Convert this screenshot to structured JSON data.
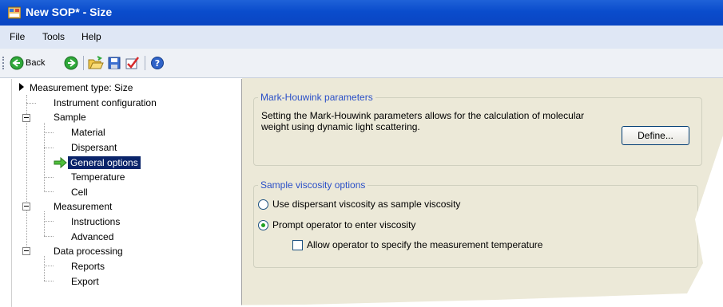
{
  "window": {
    "title": "New SOP* - Size"
  },
  "menu": {
    "items": [
      "File",
      "Tools",
      "Help"
    ]
  },
  "toolbar": {
    "back_label": "Back"
  },
  "tree": {
    "root": "Measurement type: Size",
    "items": [
      {
        "label": "Instrument configuration",
        "level": 1
      },
      {
        "label": "Sample",
        "level": 1,
        "expanded": true
      },
      {
        "label": "Material",
        "level": 2
      },
      {
        "label": "Dispersant",
        "level": 2
      },
      {
        "label": "General options",
        "level": 2,
        "selected": true
      },
      {
        "label": "Temperature",
        "level": 2
      },
      {
        "label": "Cell",
        "level": 2
      },
      {
        "label": "Measurement",
        "level": 1,
        "expanded": true
      },
      {
        "label": "Instructions",
        "level": 2
      },
      {
        "label": "Advanced",
        "level": 2
      },
      {
        "label": "Data processing",
        "level": 1,
        "expanded": true
      },
      {
        "label": "Reports",
        "level": 2
      },
      {
        "label": "Export",
        "level": 2
      }
    ]
  },
  "mark_houwink": {
    "title": "Mark-Houwink parameters",
    "description_line1": "Setting the Mark-Houwink parameters allows for the calculation of molecular",
    "description_line2": "weight using dynamic light scattering.",
    "define_button": "Define..."
  },
  "viscosity": {
    "title": "Sample viscosity options",
    "option_dispersant": "Use dispersant viscosity as sample viscosity",
    "option_prompt": "Prompt operator to enter viscosity",
    "selected": "prompt",
    "allow_temperature": "Allow operator to specify the measurement temperature",
    "allow_temperature_checked": false
  },
  "colors": {
    "titlebar": "#0a4ccc",
    "selection": "#0a246a",
    "group_title": "#2a4fc7",
    "panel_bg": "#ece9d8"
  }
}
